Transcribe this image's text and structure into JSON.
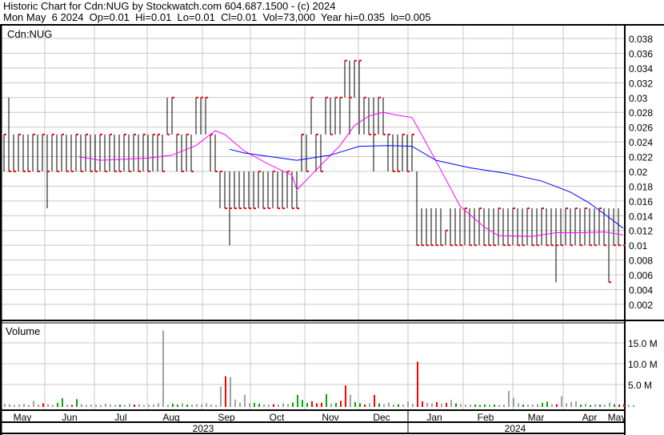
{
  "header": {
    "line1": "Historic Chart for Cdn:NUG by Stockwatch.com 604.687.1500 - (c) 2024",
    "line2": "Mon May  6 2024  Op=0.01  Hi=0.01  Lo=0.01  Cl=0.01  Vol=73,000  Year hi=0.035  lo=0.005"
  },
  "chart_data": {
    "type": "bar",
    "title": "Cdn:NUG",
    "volume_label": "Volume",
    "price_ticks": [
      "0.038",
      "0.036",
      "0.034",
      "0.032",
      "0.03",
      "0.028",
      "0.026",
      "0.024",
      "0.022",
      "0.02",
      "0.018",
      "0.016",
      "0.014",
      "0.012",
      "0.01",
      "0.008",
      "0.006",
      "0.004",
      "0.002"
    ],
    "price_tick_values": [
      0.038,
      0.036,
      0.034,
      0.032,
      0.03,
      0.028,
      0.026,
      0.024,
      0.022,
      0.02,
      0.018,
      0.016,
      0.014,
      0.012,
      0.01,
      0.008,
      0.006,
      0.004,
      0.002
    ],
    "volume_ticks": [
      "15.0 M",
      "10.0 M",
      "5.0 M"
    ],
    "volume_tick_values": [
      15,
      10,
      5
    ],
    "months": [
      "May",
      "Jun",
      "Jul",
      "Aug",
      "Sep",
      "Oct",
      "Nov",
      "Dec",
      "Jan",
      "Feb",
      "Mar",
      "Apr",
      "May"
    ],
    "years": [
      "2023",
      "2024"
    ],
    "colors": {
      "bar": "#000000",
      "close": "#ff0000",
      "ma_short": "#ff00ff",
      "ma_long": "#0000ff",
      "vol_up": "#00aa00",
      "vol_down": "#ff0000",
      "vol_flat": "#a0a0a0",
      "grid": "#c8c8c8"
    },
    "bars": [
      [
        0.025,
        0.02,
        0.025
      ],
      [
        0.03,
        0.02,
        0.02
      ],
      [
        0.025,
        0.02,
        0.02
      ],
      [
        0.025,
        0.02,
        0.025
      ],
      [
        0.025,
        0.02,
        0.02
      ],
      [
        0.025,
        0.02,
        0.02
      ],
      [
        0.025,
        0.02,
        0.025
      ],
      [
        0.025,
        0.02,
        0.02
      ],
      [
        0.025,
        0.02,
        0.025
      ],
      [
        0.025,
        0.015,
        0.02
      ],
      [
        0.025,
        0.02,
        0.025
      ],
      [
        0.025,
        0.02,
        0.02
      ],
      [
        0.025,
        0.02,
        0.025
      ],
      [
        0.025,
        0.02,
        0.02
      ],
      [
        0.025,
        0.02,
        0.02
      ],
      [
        0.025,
        0.02,
        0.025
      ],
      [
        0.025,
        0.02,
        0.02
      ],
      [
        0.025,
        0.02,
        0.025
      ],
      [
        0.025,
        0.02,
        0.02
      ],
      [
        0.025,
        0.02,
        0.02
      ],
      [
        0.025,
        0.02,
        0.025
      ],
      [
        0.025,
        0.02,
        0.02
      ],
      [
        0.025,
        0.02,
        0.025
      ],
      [
        0.025,
        0.02,
        0.02
      ],
      [
        0.025,
        0.02,
        0.02
      ],
      [
        0.025,
        0.02,
        0.025
      ],
      [
        0.025,
        0.02,
        0.02
      ],
      [
        0.025,
        0.02,
        0.025
      ],
      [
        0.025,
        0.02,
        0.02
      ],
      [
        0.025,
        0.02,
        0.025
      ],
      [
        0.025,
        0.02,
        0.02
      ],
      [
        0.025,
        0.02,
        0.025
      ],
      [
        0.025,
        0.02,
        0.025
      ],
      [
        0.025,
        0.02,
        0.02
      ],
      [
        0.03,
        0.025,
        0.025
      ],
      [
        0.03,
        0.025,
        0.03
      ],
      [
        0.025,
        0.02,
        0.025
      ],
      [
        0.025,
        0.02,
        0.02
      ],
      [
        0.025,
        0.02,
        0.025
      ],
      [
        0.025,
        0.02,
        0.02
      ],
      [
        0.03,
        0.025,
        0.03
      ],
      [
        0.03,
        0.025,
        0.03
      ],
      [
        0.03,
        0.025,
        0.03
      ],
      [
        0.025,
        0.02,
        0.025
      ],
      [
        0.025,
        0.02,
        0.02
      ],
      [
        0.02,
        0.015,
        0.02
      ],
      [
        0.02,
        0.015,
        0.015
      ],
      [
        0.02,
        0.01,
        0.015
      ],
      [
        0.02,
        0.015,
        0.015
      ],
      [
        0.02,
        0.015,
        0.015
      ],
      [
        0.02,
        0.015,
        0.015
      ],
      [
        0.02,
        0.015,
        0.015
      ],
      [
        0.02,
        0.015,
        0.015
      ],
      [
        0.02,
        0.015,
        0.02
      ],
      [
        0.02,
        0.015,
        0.015
      ],
      [
        0.02,
        0.015,
        0.015
      ],
      [
        0.02,
        0.015,
        0.02
      ],
      [
        0.02,
        0.015,
        0.015
      ],
      [
        0.02,
        0.015,
        0.015
      ],
      [
        0.02,
        0.015,
        0.02
      ],
      [
        0.02,
        0.015,
        0.015
      ],
      [
        0.02,
        0.015,
        0.015
      ],
      [
        0.025,
        0.02,
        0.025
      ],
      [
        0.025,
        0.02,
        0.02
      ],
      [
        0.03,
        0.025,
        0.03
      ],
      [
        0.025,
        0.02,
        0.025
      ],
      [
        0.025,
        0.02,
        0.02
      ],
      [
        0.03,
        0.025,
        0.03
      ],
      [
        0.03,
        0.025,
        0.025
      ],
      [
        0.03,
        0.025,
        0.03
      ],
      [
        0.03,
        0.025,
        0.03
      ],
      [
        0.035,
        0.03,
        0.035
      ],
      [
        0.035,
        0.025,
        0.03
      ],
      [
        0.035,
        0.03,
        0.035
      ],
      [
        0.035,
        0.025,
        0.035
      ],
      [
        0.03,
        0.025,
        0.03
      ],
      [
        0.03,
        0.025,
        0.025
      ],
      [
        0.03,
        0.02,
        0.025
      ],
      [
        0.03,
        0.025,
        0.03
      ],
      [
        0.03,
        0.025,
        0.025
      ],
      [
        0.025,
        0.02,
        0.025
      ],
      [
        0.025,
        0.02,
        0.02
      ],
      [
        0.025,
        0.02,
        0.02
      ],
      [
        0.025,
        0.02,
        0.025
      ],
      [
        0.025,
        0.02,
        0.02
      ],
      [
        0.025,
        0.02,
        0.025
      ],
      [
        0.02,
        0.01,
        0.01
      ],
      [
        0.015,
        0.01,
        0.01
      ],
      [
        0.015,
        0.01,
        0.01
      ],
      [
        0.015,
        0.01,
        0.01
      ],
      [
        0.015,
        0.01,
        0.01
      ],
      [
        0.015,
        0.01,
        0.01
      ],
      [
        0.012,
        0.01,
        0.012
      ],
      [
        0.015,
        0.01,
        0.01
      ],
      [
        0.015,
        0.01,
        0.01
      ],
      [
        0.015,
        0.01,
        0.01
      ],
      [
        0.015,
        0.01,
        0.015
      ],
      [
        0.015,
        0.01,
        0.01
      ],
      [
        0.015,
        0.01,
        0.01
      ],
      [
        0.015,
        0.01,
        0.015
      ],
      [
        0.015,
        0.01,
        0.01
      ],
      [
        0.015,
        0.01,
        0.01
      ],
      [
        0.015,
        0.01,
        0.01
      ],
      [
        0.015,
        0.01,
        0.015
      ],
      [
        0.015,
        0.01,
        0.01
      ],
      [
        0.015,
        0.01,
        0.01
      ],
      [
        0.015,
        0.01,
        0.015
      ],
      [
        0.015,
        0.01,
        0.01
      ],
      [
        0.015,
        0.01,
        0.01
      ],
      [
        0.015,
        0.01,
        0.015
      ],
      [
        0.015,
        0.01,
        0.01
      ],
      [
        0.015,
        0.01,
        0.01
      ],
      [
        0.015,
        0.01,
        0.015
      ],
      [
        0.015,
        0.01,
        0.01
      ],
      [
        0.015,
        0.01,
        0.01
      ],
      [
        0.015,
        0.005,
        0.01
      ],
      [
        0.015,
        0.01,
        0.01
      ],
      [
        0.015,
        0.01,
        0.015
      ],
      [
        0.015,
        0.01,
        0.01
      ],
      [
        0.015,
        0.01,
        0.015
      ],
      [
        0.015,
        0.01,
        0.01
      ],
      [
        0.015,
        0.01,
        0.015
      ],
      [
        0.015,
        0.01,
        0.01
      ],
      [
        0.015,
        0.01,
        0.01
      ],
      [
        0.015,
        0.01,
        0.015
      ],
      [
        0.015,
        0.01,
        0.01
      ],
      [
        0.015,
        0.005,
        0.005
      ],
      [
        0.015,
        0.01,
        0.01
      ],
      [
        0.015,
        0.01,
        0.01
      ],
      [
        0.01,
        0.01,
        0.01
      ]
    ],
    "volume": [
      0.4,
      0.3,
      0.1,
      0.2,
      0.4,
      0.1,
      1.1,
      0.2,
      0.5,
      0.3,
      0.1,
      0.6,
      1.7,
      0.2,
      0.1,
      1.5,
      0.3,
      0.1,
      0.2,
      0.2,
      0.1,
      0.4,
      0.2,
      0.1,
      0.2,
      0.1,
      0.4,
      0.2,
      0.3,
      0.1,
      0.2,
      0.2,
      0.5,
      18,
      0.2,
      0.4,
      0.2,
      0.5,
      0.2,
      0.2,
      0.3,
      0.2,
      0.5,
      0.2,
      0.1,
      4.5,
      7,
      6.8,
      1.4,
      0.7,
      2.5,
      0.5,
      0.6,
      0.4,
      0.2,
      0.2,
      0.3,
      0.2,
      0.5,
      0.3,
      0.7,
      2.5,
      1.3,
      0.6,
      1.0,
      0.5,
      0.6,
      2.7,
      0.4,
      0.6,
      1.1,
      4.8,
      2.5,
      0.8,
      0.5,
      0.2,
      0.5,
      2.5,
      0.5,
      0.3,
      0.7,
      0.2,
      0.3,
      0.2,
      0.9,
      0.4,
      10.5,
      1.0,
      0.6,
      0.5,
      0.8,
      0.4,
      0.6,
      1.3,
      0.5,
      0.3,
      0.2,
      0.2,
      0.2,
      0.1,
      0.2,
      0.2,
      0.2,
      0.1,
      0.2,
      3.5,
      1.8,
      0.5,
      0.2,
      0.2,
      0.2,
      0.3,
      0.6,
      0.9,
      0.3,
      0.3,
      2.2,
      0.5,
      0.8,
      1.0,
      0.2,
      0.4,
      0.1,
      0.3,
      0.2,
      0.2,
      0.7,
      0.3,
      0.2,
      0.3,
      0.1,
      0.1
    ],
    "volume_color": [
      "f",
      "f",
      "f",
      "f",
      "f",
      "f",
      "f",
      "f",
      "d",
      "f",
      "f",
      "u",
      "u",
      "f",
      "d",
      "u",
      "f",
      "f",
      "f",
      "f",
      "f",
      "f",
      "f",
      "f",
      "u",
      "f",
      "f",
      "d",
      "f",
      "f",
      "f",
      "f",
      "f",
      "f",
      "f",
      "u",
      "u",
      "f",
      "u",
      "f",
      "f",
      "f",
      "f",
      "f",
      "f",
      "f",
      "d",
      "f",
      "f",
      "f",
      "f",
      "f",
      "u",
      "u",
      "f",
      "f",
      "d",
      "f",
      "f",
      "f",
      "u",
      "u",
      "u",
      "u",
      "d",
      "d",
      "d",
      "u",
      "f",
      "u",
      "d",
      "d",
      "f",
      "u",
      "u",
      "d",
      "f",
      "d",
      "u",
      "f",
      "f",
      "f",
      "u",
      "f",
      "f",
      "f",
      "d",
      "d",
      "f",
      "f",
      "d",
      "f",
      "d",
      "f",
      "u",
      "f",
      "f",
      "f",
      "u",
      "u",
      "u",
      "f",
      "u",
      "f",
      "f",
      "f",
      "f",
      "f",
      "u",
      "f",
      "f",
      "f",
      "u",
      "u",
      "f",
      "d",
      "f",
      "f",
      "f",
      "f",
      "u",
      "f",
      "u",
      "f",
      "u",
      "f",
      "f",
      "u",
      "d",
      "d"
    ],
    "ma_short": [
      [
        15.5,
        0.022
      ],
      [
        20,
        0.0215
      ],
      [
        30,
        0.0218
      ],
      [
        35,
        0.0222
      ],
      [
        40,
        0.0235
      ],
      [
        44,
        0.0255
      ],
      [
        46,
        0.025
      ],
      [
        50,
        0.0228
      ],
      [
        55,
        0.021
      ],
      [
        60,
        0.0195
      ],
      [
        61,
        0.0175
      ],
      [
        64,
        0.0195
      ],
      [
        67,
        0.0215
      ],
      [
        70,
        0.0235
      ],
      [
        73,
        0.0262
      ],
      [
        76,
        0.0275
      ],
      [
        79,
        0.028
      ],
      [
        82,
        0.0276
      ],
      [
        85,
        0.0273
      ],
      [
        87,
        0.025
      ],
      [
        92,
        0.019
      ],
      [
        95,
        0.0153
      ],
      [
        100,
        0.0125
      ],
      [
        103,
        0.0113
      ],
      [
        110,
        0.0112
      ],
      [
        115,
        0.0117
      ],
      [
        120,
        0.0117
      ],
      [
        125,
        0.0118
      ],
      [
        129,
        0.0114
      ]
    ],
    "ma_long": [
      [
        47,
        0.023
      ],
      [
        50,
        0.0225
      ],
      [
        61,
        0.0215
      ],
      [
        68,
        0.0222
      ],
      [
        74,
        0.0234
      ],
      [
        80,
        0.0235
      ],
      [
        85,
        0.0234
      ],
      [
        90,
        0.0215
      ],
      [
        97,
        0.0205
      ],
      [
        105,
        0.0197
      ],
      [
        112,
        0.0187
      ],
      [
        118,
        0.0172
      ],
      [
        122,
        0.0157
      ],
      [
        126,
        0.0138
      ],
      [
        129,
        0.0123
      ]
    ],
    "ylim": [
      0,
      0.039
    ]
  }
}
